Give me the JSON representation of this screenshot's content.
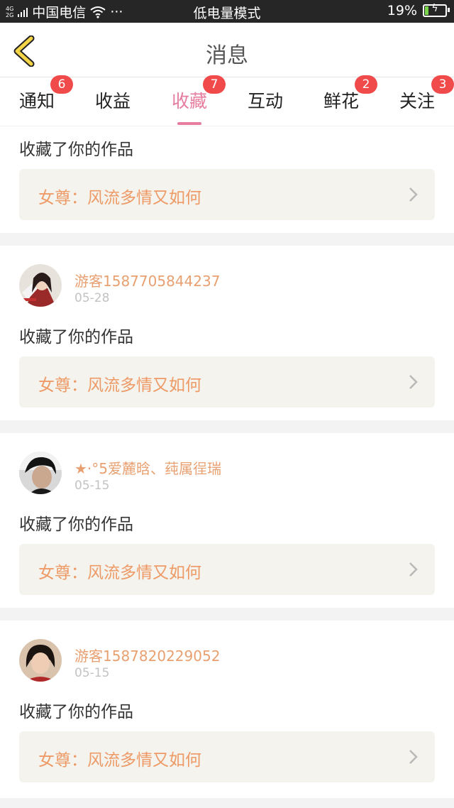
{
  "status_bar": {
    "network_top": "4G",
    "network_bottom": "2G",
    "carrier": "中国电信",
    "more": "···",
    "mode": "低电量模式",
    "battery": "19%",
    "battery_level": 0.19,
    "battery_color": "#7ad54a"
  },
  "header": {
    "title": "消息"
  },
  "tabs": [
    {
      "label": "通知",
      "badge": "6",
      "active": false
    },
    {
      "label": "收益",
      "badge": "",
      "active": false
    },
    {
      "label": "收藏",
      "badge": "7",
      "active": true
    },
    {
      "label": "互动",
      "badge": "",
      "active": false
    },
    {
      "label": "鲜花",
      "badge": "2",
      "active": false
    },
    {
      "label": "关注",
      "badge": "3",
      "active": false
    }
  ],
  "colors": {
    "accent": "#e67c9e",
    "badge": "#f14a4a",
    "username": "#e8a070",
    "work_title": "#ee9a66",
    "work_bg": "#f4f3ee"
  },
  "items": [
    {
      "username": "",
      "date": "",
      "action": "收藏了你的作品",
      "work_title": "女尊：风流多情又如何"
    },
    {
      "username": "游客1587705844237",
      "date": "05-28",
      "action": "收藏了你的作品",
      "work_title": "女尊：风流多情又如何"
    },
    {
      "username": "★·°5爱麓晗、莼属徎瑞",
      "date": "05-15",
      "action": "收藏了你的作品",
      "work_title": "女尊：风流多情又如何"
    },
    {
      "username": "游客1587820229052",
      "date": "05-15",
      "action": "收藏了你的作品",
      "work_title": "女尊：风流多情又如何"
    }
  ]
}
